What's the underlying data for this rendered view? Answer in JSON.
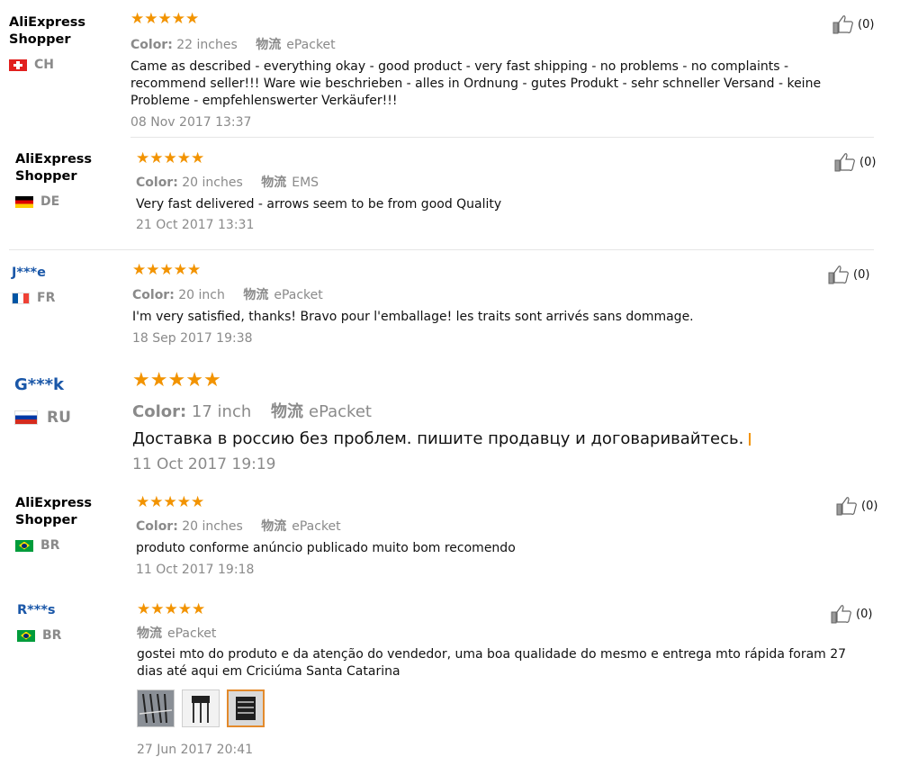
{
  "like_icon": "thumbs-up-icon",
  "star_color": "#f29300",
  "reviews": [
    {
      "user": "AliExpress Shopper",
      "user_line1": "AliExpress",
      "user_line2": "Shopper",
      "country": "CH",
      "rating": 5,
      "color_label": "Color:",
      "color_value": "22 inches",
      "logistics_label": "物流",
      "logistics_value": "ePacket",
      "text": "Came as described - everything okay - good product - very fast shipping - no problems - no complaints - recommend seller!!! Ware wie beschrieben - alles in Ordnung - gutes Produkt - sehr schneller Versand - keine Probleme - empfehlenswerter Verkäufer!!!",
      "date": "08 Nov 2017 13:37",
      "likes": "(0)"
    },
    {
      "user_line1": "AliExpress",
      "user_line2": "Shopper",
      "country": "DE",
      "rating": 5,
      "color_label": "Color:",
      "color_value": "20 inches",
      "logistics_label": "物流",
      "logistics_value": "EMS",
      "text": "Very fast delivered - arrows seem to be from good Quality",
      "date": "21 Oct 2017 13:31",
      "likes": "(0)"
    },
    {
      "user_line1": "J***e",
      "country": "FR",
      "rating": 5,
      "color_label": "Color:",
      "color_value": "20 inch",
      "logistics_label": "物流",
      "logistics_value": "ePacket",
      "text": "I'm very satisfied, thanks! Bravo pour l'emballage! les traits sont arrivés sans dommage.",
      "date": "18 Sep 2017 19:38",
      "likes": "(0)"
    },
    {
      "user_line1": "G***k",
      "country": "RU",
      "rating": 5,
      "color_label": "Color:",
      "color_value": "17 inch",
      "logistics_label": "物流",
      "logistics_value": "ePacket",
      "text": "Доставка в россию без проблем. пишите продавцу и договаривайтесь.",
      "date": "11 Oct 2017 19:19"
    },
    {
      "user_line1": "AliExpress",
      "user_line2": "Shopper",
      "country": "BR",
      "rating": 5,
      "color_label": "Color:",
      "color_value": "20 inches",
      "logistics_label": "物流",
      "logistics_value": "ePacket",
      "text": "produto conforme anúncio publicado muito bom recomendo",
      "date": "11 Oct 2017 19:18",
      "likes": "(0)"
    },
    {
      "user_line1": "R***s",
      "country": "BR",
      "rating": 5,
      "logistics_label": "物流",
      "logistics_value": "ePacket",
      "text": "gostei mto do produto e da atenção do vendedor, uma boa qualidade do mesmo e entrega mto rápida foram 27 dias até aqui em Criciúma Santa Catarina",
      "photos": [
        "review-photo",
        "review-photo",
        "review-photo"
      ],
      "date": "27 Jun 2017 20:41",
      "likes": "(0)"
    }
  ]
}
